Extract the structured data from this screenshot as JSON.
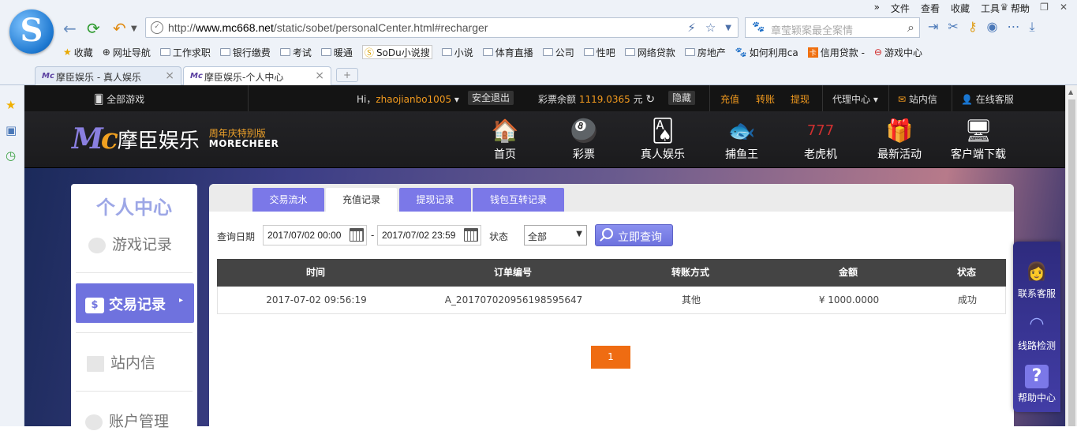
{
  "browser": {
    "menu": [
      "文件",
      "查看",
      "收藏",
      "工具",
      "帮助"
    ],
    "url_prefix": "http://",
    "url_host": "www.mc668.net",
    "url_path": "/static/sobet/personalCenter.html#recharger",
    "search_placeholder": "章莹颖案最全案情",
    "bookmarks": [
      "收藏",
      "网址导航",
      "工作求职",
      "银行缴费",
      "考试",
      "暖通",
      "SoDu小说搜",
      "小说",
      "体育直播",
      "公司",
      "性吧",
      "网络贷款",
      "房地产",
      "如何利用ca",
      "信用贷款 -",
      "游戏中心"
    ],
    "tabs": [
      {
        "label": "摩臣娱乐 - 真人娱乐"
      },
      {
        "label": "摩臣娱乐-个人中心"
      }
    ]
  },
  "site": {
    "topbar": {
      "all_games": "全部游戏",
      "greeting": "Hi，",
      "username": "zhaojianbo1005",
      "logout": "安全退出",
      "balance_label": "彩票余额",
      "balance": "1119.0365",
      "currency": "元",
      "hide": "隐藏",
      "recharge": "充值",
      "transfer": "转账",
      "withdraw": "提现",
      "agent": "代理中心",
      "messages": "站内信",
      "support": "在线客服"
    },
    "brand": {
      "name": "摩臣娱乐",
      "badge": "周年庆特别版",
      "en": "MORECHEER"
    },
    "nav": [
      "首页",
      "彩票",
      "真人娱乐",
      "捕鱼王",
      "老虎机",
      "最新活动",
      "客户端下载"
    ]
  },
  "sidebar": {
    "title": "个人中心",
    "items": [
      "游戏记录",
      "交易记录",
      "站内信",
      "账户管理"
    ]
  },
  "panel": {
    "tabs": [
      "交易流水",
      "充值记录",
      "提现记录",
      "钱包互转记录"
    ],
    "query": {
      "date_label": "查询日期",
      "date_from": "2017/07/02 00:00",
      "dash": "-",
      "date_to": "2017/07/02 23:59",
      "status_label": "状态",
      "status_value": "全部",
      "submit": "立即查询"
    },
    "columns": [
      "时间",
      "订单编号",
      "转账方式",
      "金额",
      "状态"
    ],
    "rows": [
      [
        "2017-07-02 09:56:19",
        "A_20170702095619859564 7",
        "其他",
        "¥ 1000.0000",
        "成功"
      ]
    ],
    "page": "1"
  },
  "float_menu": [
    "联系客服",
    "线路检测",
    "帮助中心"
  ]
}
